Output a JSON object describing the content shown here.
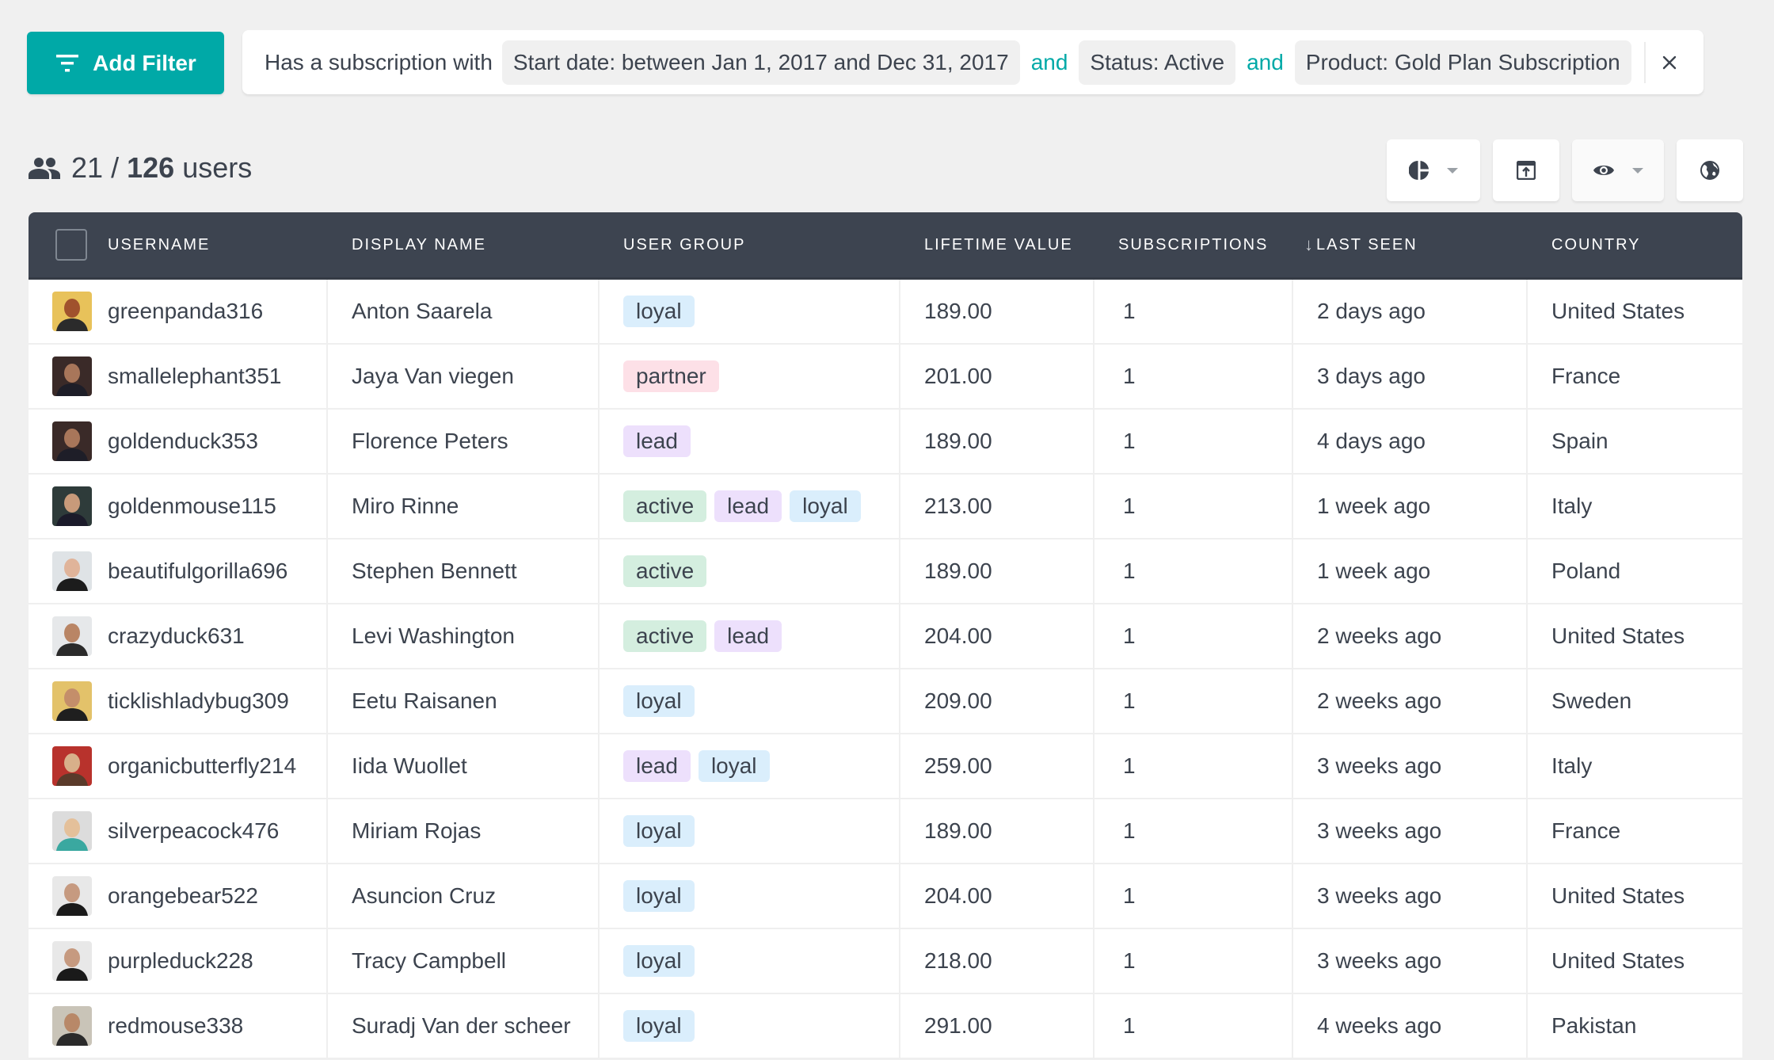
{
  "filter": {
    "add_filter_label": "Add Filter",
    "prefix": "Has a subscription with",
    "conditions": [
      "Start date: between Jan 1, 2017 and Dec 31, 2017",
      "Status: Active",
      "Product: Gold Plan Subscription"
    ],
    "conjunction": "and",
    "clear_icon": "close-icon"
  },
  "summary": {
    "shown": "21",
    "separator": "/",
    "total": "126",
    "unit": "users"
  },
  "toolbar": {
    "buttons": [
      {
        "icon": "pie-chart-icon",
        "has_dropdown": true
      },
      {
        "icon": "export-icon",
        "has_dropdown": false
      },
      {
        "icon": "eye-icon",
        "has_dropdown": true
      },
      {
        "icon": "globe-icon",
        "has_dropdown": false
      }
    ]
  },
  "colors": {
    "accent": "#00a9a7",
    "header_bg": "#3d4450",
    "text": "#3c434e",
    "tag_loyal": "#daeefc",
    "tag_partner": "#fde0e7",
    "tag_lead": "#ede0fc",
    "tag_active": "#d4eedf"
  },
  "table": {
    "columns": [
      "USERNAME",
      "DISPLAY NAME",
      "USER GROUP",
      "LIFETIME VALUE",
      "SUBSCRIPTIONS",
      "LAST SEEN",
      "COUNTRY"
    ],
    "sorted_column": "LAST SEEN",
    "sort_direction_glyph": "↓",
    "rows": [
      {
        "username": "greenpanda316",
        "display_name": "Anton Saarela",
        "groups": [
          "loyal"
        ],
        "lifetime_value": "189.00",
        "subscriptions": "1",
        "last_seen": "2 days ago",
        "country": "United States"
      },
      {
        "username": "smallelephant351",
        "display_name": "Jaya Van viegen",
        "groups": [
          "partner"
        ],
        "lifetime_value": "201.00",
        "subscriptions": "1",
        "last_seen": "3 days ago",
        "country": "France"
      },
      {
        "username": "goldenduck353",
        "display_name": "Florence Peters",
        "groups": [
          "lead"
        ],
        "lifetime_value": "189.00",
        "subscriptions": "1",
        "last_seen": "4 days ago",
        "country": "Spain"
      },
      {
        "username": "goldenmouse115",
        "display_name": "Miro Rinne",
        "groups": [
          "active",
          "lead",
          "loyal"
        ],
        "lifetime_value": "213.00",
        "subscriptions": "1",
        "last_seen": "1 week ago",
        "country": "Italy"
      },
      {
        "username": "beautifulgorilla696",
        "display_name": "Stephen Bennett",
        "groups": [
          "active"
        ],
        "lifetime_value": "189.00",
        "subscriptions": "1",
        "last_seen": "1 week ago",
        "country": "Poland"
      },
      {
        "username": "crazyduck631",
        "display_name": "Levi Washington",
        "groups": [
          "active",
          "lead"
        ],
        "lifetime_value": "204.00",
        "subscriptions": "1",
        "last_seen": "2 weeks ago",
        "country": "United States"
      },
      {
        "username": "ticklishladybug309",
        "display_name": "Eetu Raisanen",
        "groups": [
          "loyal"
        ],
        "lifetime_value": "209.00",
        "subscriptions": "1",
        "last_seen": "2 weeks ago",
        "country": "Sweden"
      },
      {
        "username": "organicbutterfly214",
        "display_name": "Iida Wuollet",
        "groups": [
          "lead",
          "loyal"
        ],
        "lifetime_value": "259.00",
        "subscriptions": "1",
        "last_seen": "3 weeks ago",
        "country": "Italy"
      },
      {
        "username": "silverpeacock476",
        "display_name": "Miriam Rojas",
        "groups": [
          "loyal"
        ],
        "lifetime_value": "189.00",
        "subscriptions": "1",
        "last_seen": "3 weeks ago",
        "country": "France"
      },
      {
        "username": "orangebear522",
        "display_name": "Asuncion Cruz",
        "groups": [
          "loyal"
        ],
        "lifetime_value": "204.00",
        "subscriptions": "1",
        "last_seen": "3 weeks ago",
        "country": "United States"
      },
      {
        "username": "purpleduck228",
        "display_name": "Tracy Campbell",
        "groups": [
          "loyal"
        ],
        "lifetime_value": "218.00",
        "subscriptions": "1",
        "last_seen": "3 weeks ago",
        "country": "United States"
      },
      {
        "username": "redmouse338",
        "display_name": "Suradj Van der scheer",
        "groups": [
          "loyal"
        ],
        "lifetime_value": "291.00",
        "subscriptions": "1",
        "last_seen": "4 weeks ago",
        "country": "Pakistan"
      }
    ]
  }
}
